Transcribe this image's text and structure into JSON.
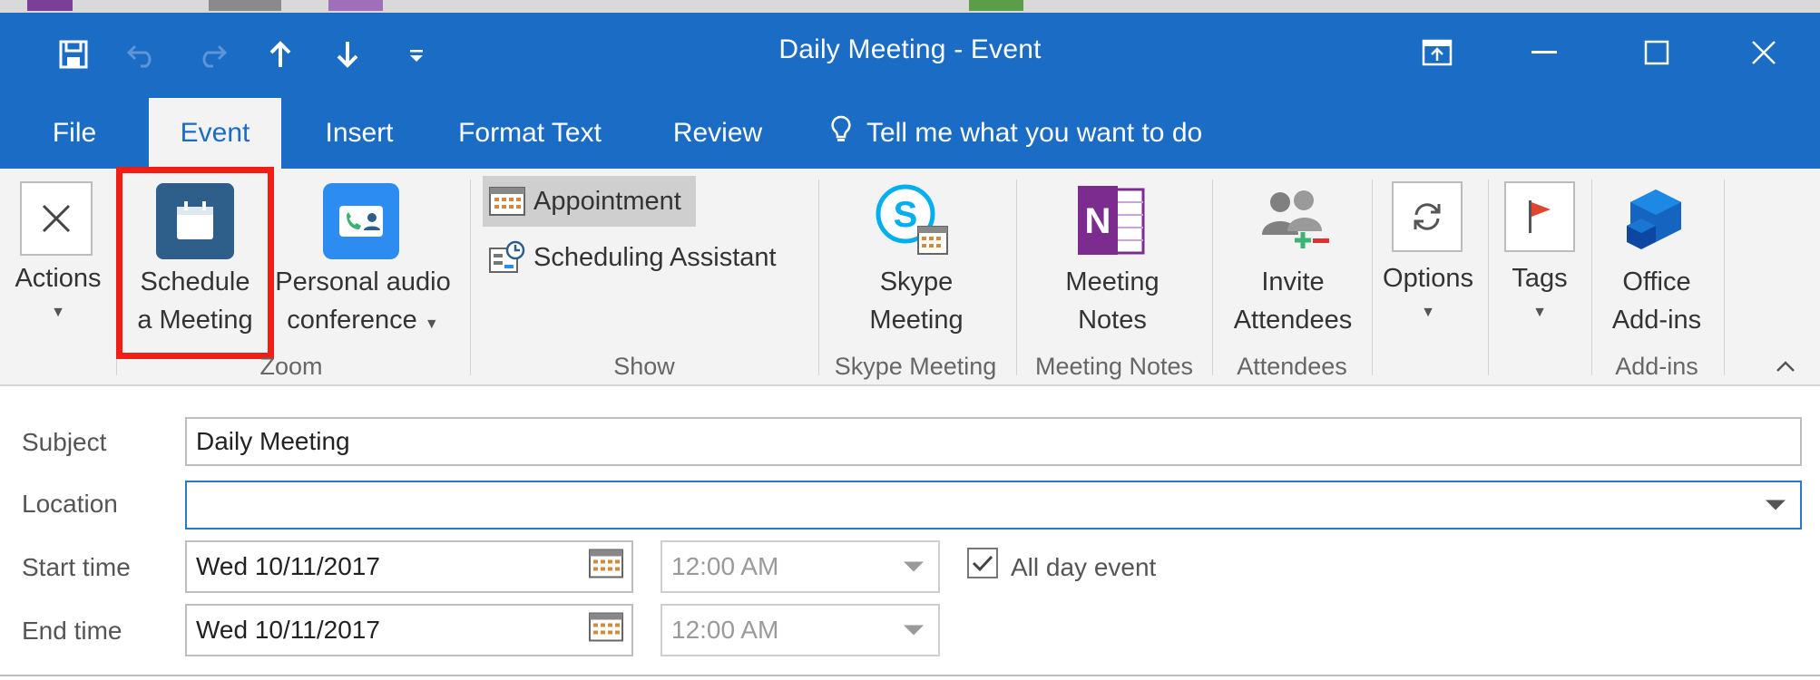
{
  "window": {
    "title": "Daily Meeting  -  Event"
  },
  "tabs": [
    {
      "label": "File"
    },
    {
      "label": "Event"
    },
    {
      "label": "Insert"
    },
    {
      "label": "Format Text"
    },
    {
      "label": "Review"
    }
  ],
  "tell_me": "Tell me what you want to do",
  "ribbon": {
    "actions": {
      "label": "Actions"
    },
    "schedule": {
      "line1": "Schedule",
      "line2": "a Meeting"
    },
    "personal_audio": {
      "line1": "Personal audio",
      "line2": "conference"
    },
    "zoom_group": "Zoom",
    "appointment": "Appointment",
    "scheduling_assistant": "Scheduling Assistant",
    "show_group": "Show",
    "skype": {
      "line1": "Skype",
      "line2": "Meeting"
    },
    "skype_group": "Skype Meeting",
    "notes": {
      "line1": "Meeting",
      "line2": "Notes"
    },
    "notes_group": "Meeting Notes",
    "invite": {
      "line1": "Invite",
      "line2": "Attendees"
    },
    "attendees_group": "Attendees",
    "options": "Options",
    "tags": "Tags",
    "addins": {
      "line1": "Office",
      "line2": "Add-ins"
    },
    "addins_group": "Add-ins"
  },
  "form": {
    "subject": {
      "label": "Subject",
      "value": "Daily Meeting"
    },
    "location": {
      "label": "Location",
      "value": ""
    },
    "start": {
      "label": "Start time",
      "date": "Wed 10/11/2017",
      "time": "12:00 AM"
    },
    "end": {
      "label": "End time",
      "date": "Wed 10/11/2017",
      "time": "12:00 AM"
    },
    "all_day": {
      "label": "All day event",
      "checked": true
    }
  },
  "colors": {
    "title_bar": "#1a6cc4",
    "ribbon": "#f3f3f3",
    "highlight": "#f21d14",
    "onenote": "#7b2c8e",
    "skype": "#00aff0"
  }
}
